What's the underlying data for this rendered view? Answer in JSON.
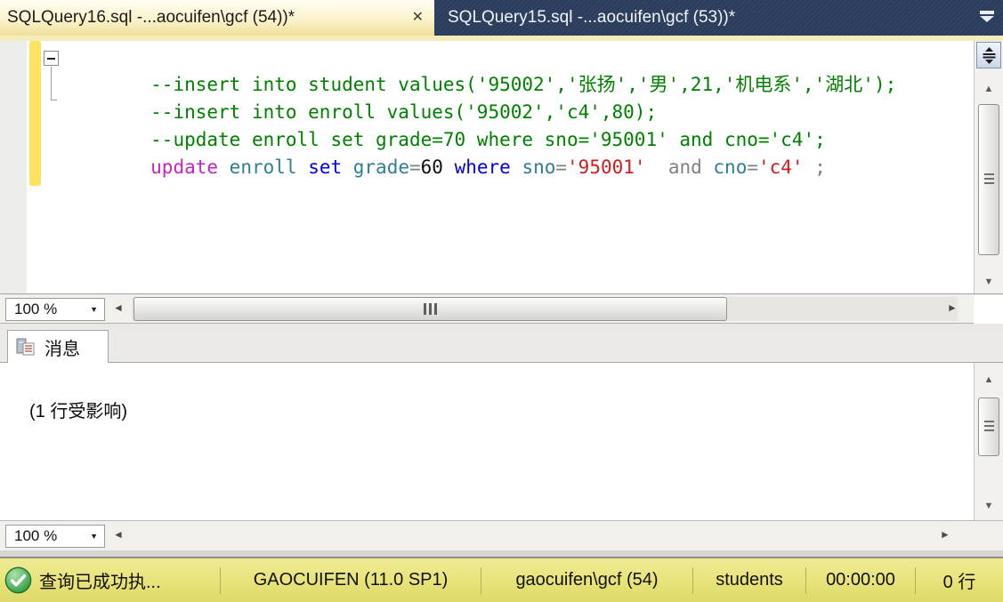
{
  "window": {
    "tabs": [
      {
        "label": "SQLQuery16.sql -...aocuifen\\gcf (54))*",
        "active": true
      },
      {
        "label": "SQLQuery15.sql -...aocuifen\\gcf (53))*",
        "active": false
      }
    ],
    "close_glyph": "✕"
  },
  "editor": {
    "zoom_level": "100 %",
    "code_lines": [
      {
        "tokens": [
          {
            "text": "--insert into student values('95002','张扬','男',21,'机电系','湖北');",
            "type": "comment"
          }
        ]
      },
      {
        "tokens": [
          {
            "text": "--insert into enroll values('95002','c4',80);",
            "type": "comment"
          }
        ]
      },
      {
        "tokens": [
          {
            "text": "--update enroll set grade=70 where sno='95001' and cno='c4';",
            "type": "comment"
          }
        ]
      },
      {
        "tokens": [
          {
            "text": "update ",
            "type": "keyword-magenta"
          },
          {
            "text": "enroll ",
            "type": "identifier"
          },
          {
            "text": "set ",
            "type": "keyword"
          },
          {
            "text": "grade",
            "type": "identifier"
          },
          {
            "text": "=",
            "type": "operator"
          },
          {
            "text": "60 ",
            "type": "number"
          },
          {
            "text": "where ",
            "type": "keyword"
          },
          {
            "text": "sno",
            "type": "identifier"
          },
          {
            "text": "=",
            "type": "operator"
          },
          {
            "text": "'95001'",
            "type": "string"
          },
          {
            "text": "  and ",
            "type": "operator"
          },
          {
            "text": "cno",
            "type": "identifier"
          },
          {
            "text": "=",
            "type": "operator"
          },
          {
            "text": "'c4'",
            "type": "string"
          },
          {
            "text": " ;",
            "type": "operator"
          }
        ]
      }
    ]
  },
  "messages_panel": {
    "tab_label": "消息",
    "message_text": "(1 行受影响)",
    "zoom_level": "100 %"
  },
  "status_bar": {
    "status_text": "查询已成功执...",
    "server": "GAOCUIFEN (11.0 SP1)",
    "connection": "gaocuifen\\gcf (54)",
    "database": "students",
    "elapsed_time": "00:00:00",
    "row_count": "0 行"
  },
  "colors": {
    "active_tab_bg": "#f6e9ae",
    "tab_bar_bg": "#2b3d5c",
    "tab_strip_accent": "#f5ecbb",
    "change_tracking_bar": "#ffe25e",
    "status_bar_bg": "#e7e276",
    "success_icon_green": "#2b9a3d",
    "syntax": {
      "comment": "#008000",
      "keyword": "#0000e6",
      "keyword_magenta": "#c623c6",
      "identifier": "#2d7f95",
      "string": "#cf1d1d",
      "operator": "#808080",
      "number": "#101010"
    }
  }
}
